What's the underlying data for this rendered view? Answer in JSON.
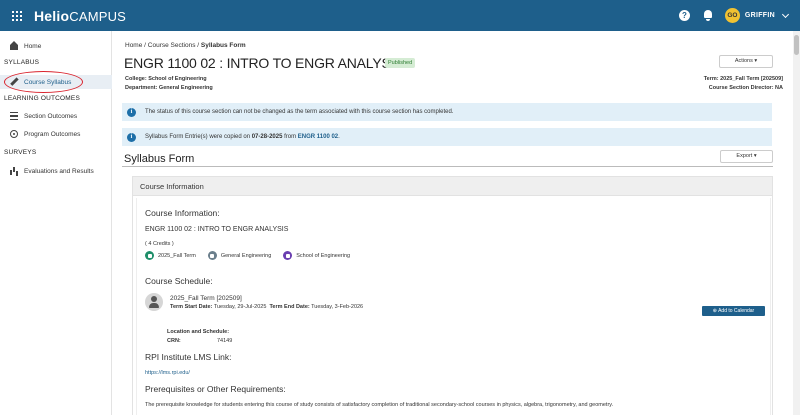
{
  "topbar": {
    "logo_bold": "Helio",
    "logo_rest": "CAMPUS",
    "help_glyph": "?",
    "user_initials": "GO",
    "user_name": "GRIFFIN"
  },
  "sidebar": {
    "home": "Home",
    "section_syllabus": "SYLLABUS",
    "course_syllabus": "Course Syllabus",
    "section_outcomes": "LEARNING OUTCOMES",
    "section_outcomes_item": "Section Outcomes",
    "program_outcomes": "Program Outcomes",
    "section_surveys": "SURVEYS",
    "evaluations": "Evaluations and Results"
  },
  "breadcrumb": {
    "home": "Home /",
    "sections": "Course Sections /",
    "current": "Syllabus Form"
  },
  "course": {
    "title": "ENGR 1100 02 : INTRO TO ENGR ANALYSIS",
    "status": "Published",
    "actions_label": "Actions ▾",
    "college": "College: School of Engineering",
    "department": "Department: General Engineering",
    "term": "Term: 2025_Fall Term [202509]",
    "director": "Course Section Director: NA"
  },
  "notices": {
    "status_msg": "The status of this course section can not be changed as the term associated with this course section has completed.",
    "copied_prefix": "Syllabus Form Entrie(s) were copied on ",
    "copied_date": "07-28-2025",
    "copied_mid": " from ",
    "copied_link": "ENGR 1100 02",
    "copied_suffix": "."
  },
  "form": {
    "title": "Syllabus Form",
    "export_label": "Export ▾",
    "panel_title": "Course Information",
    "info_heading": "Course Information:",
    "course_name": "ENGR 1100 02 : INTRO TO ENGR ANALYSIS",
    "credits": "( 4 Credits )",
    "tag_term": "2025_Fall Term",
    "tag_dept": "General Engineering",
    "tag_school": "School of Engineering",
    "schedule_heading": "Course Schedule:",
    "schedule_term": "2025_Fall Term [202509]",
    "start_label": "Term Start Date:",
    "start_value": " Tuesday, 29-Jul-2025",
    "end_label": "Term End Date:",
    "end_value": " Tuesday, 3-Feb-2026",
    "calendar_btn": "Add to Calendar",
    "location_label": "Location and Schedule:",
    "crn_label": "CRN:",
    "crn_value": "74149",
    "lms_heading": "RPI Institute LMS Link:",
    "lms_link": "https://lms.rpi.edu/",
    "prereq_heading": "Prerequisites or Other Requirements:",
    "prereq_text": "The prerequisite knowledge for students entering this course of study consists of satisfactory completion of traditional secondary-school courses in physics, algebra, trigonometry, and geometry."
  },
  "colors": {
    "topbar": "#1e5f8b",
    "tag_term": "#1f8f6a",
    "tag_dept": "#6b7f8c",
    "tag_school": "#6a3fb0"
  }
}
